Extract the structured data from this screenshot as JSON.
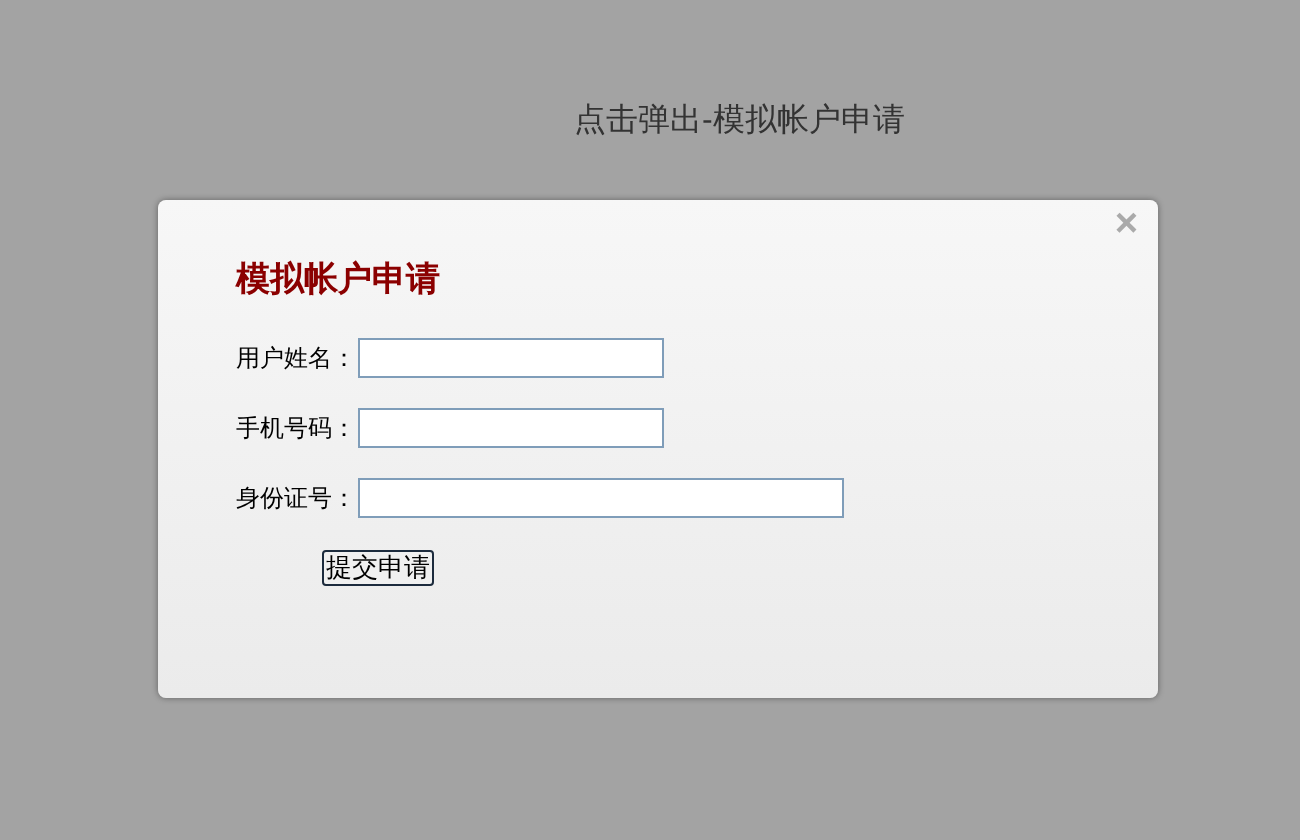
{
  "trigger_link": "点击弹出-模拟帐户申请",
  "dialog": {
    "close": "×",
    "title": "模拟帐户申请",
    "fields": [
      {
        "label": "用户姓名：",
        "kind": "short"
      },
      {
        "label": "手机号码：",
        "kind": "short"
      },
      {
        "label": "身份证号：",
        "kind": "long"
      }
    ],
    "submit": "提交申请"
  }
}
